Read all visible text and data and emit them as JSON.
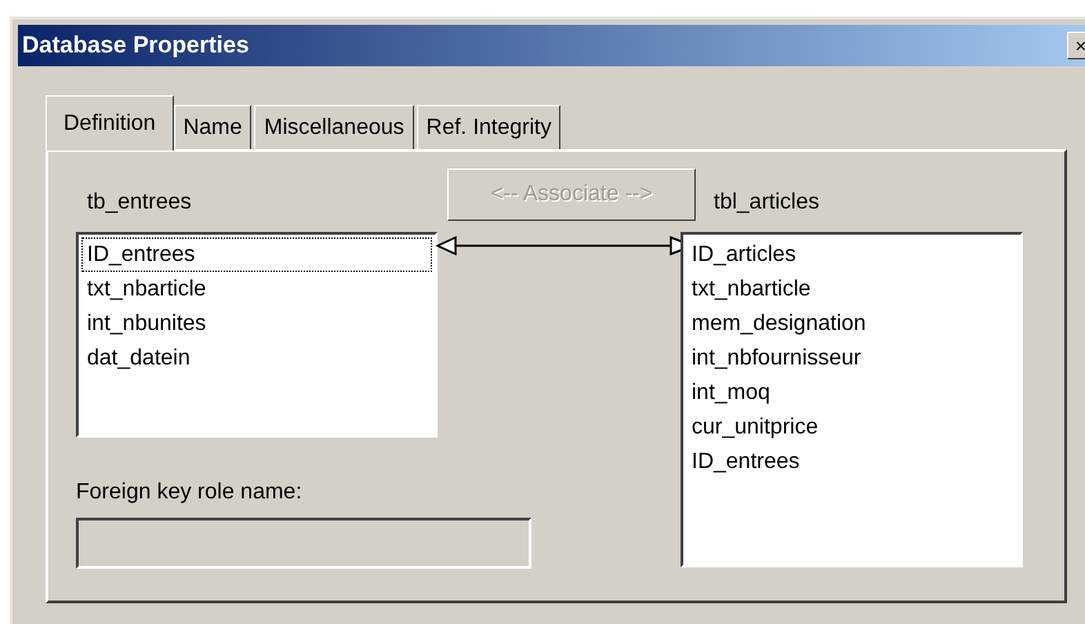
{
  "window": {
    "title": "Database Properties",
    "close": "×"
  },
  "tabs": [
    {
      "label": "Definition",
      "selected": true
    },
    {
      "label": "Name",
      "selected": false
    },
    {
      "label": "Miscellaneous",
      "selected": false
    },
    {
      "label": "Ref. Integrity",
      "selected": false
    }
  ],
  "left_table": {
    "label": "tb_entrees",
    "items": [
      {
        "text": "ID_entrees",
        "focused": true
      },
      {
        "text": "txt_nbarticle",
        "focused": false
      },
      {
        "text": "int_nbunites",
        "focused": false
      },
      {
        "text": "dat_datein",
        "focused": false
      }
    ]
  },
  "associate_button": {
    "label": "<-- Associate -->",
    "disabled": true
  },
  "right_table": {
    "label": "tbl_articles",
    "items": [
      "ID_articles",
      "txt_nbarticle",
      "mem_designation",
      "int_nbfournisseur",
      "int_moq",
      "cur_unitprice",
      "ID_entrees"
    ]
  },
  "foreign_key": {
    "label": "Foreign key role name:",
    "disabled": true
  }
}
